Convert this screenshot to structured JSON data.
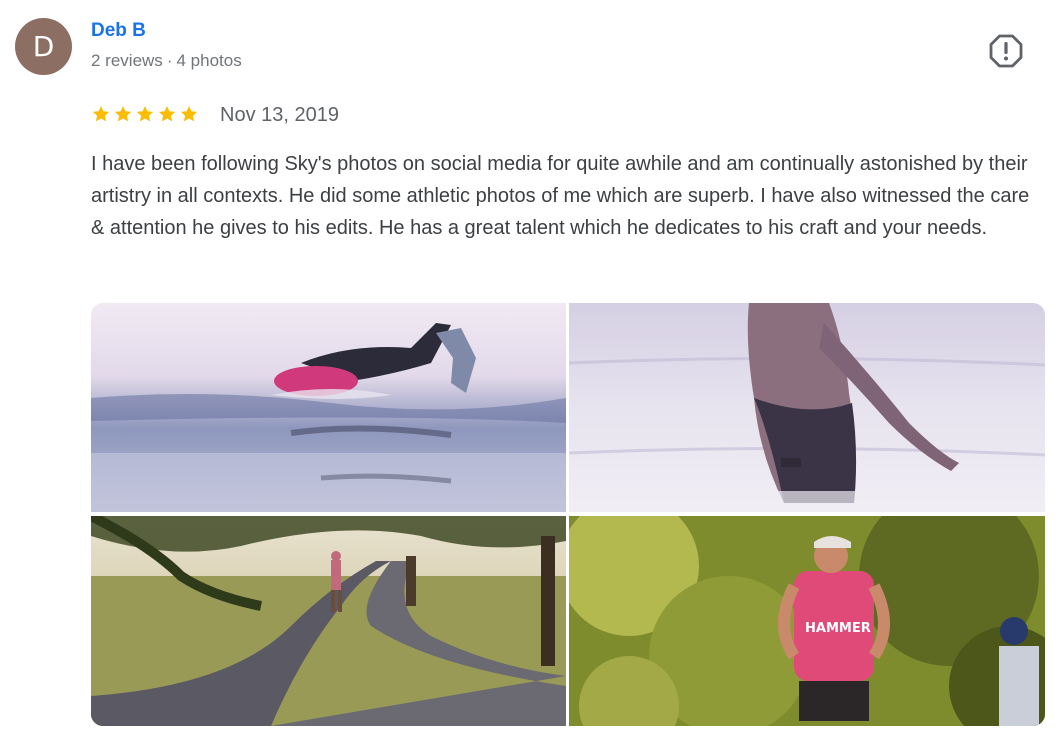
{
  "author": {
    "initial": "D",
    "name": "Deb B",
    "reviews": "2 reviews",
    "separator": "·",
    "photos": "4 photos",
    "avatar_color": "#8d6e63"
  },
  "report_icon": "report-flag-icon",
  "rating": {
    "stars": 5,
    "max": 5,
    "star_color": "#fbbc04"
  },
  "date": "Nov 13, 2019",
  "review_text": "I have been following Sky's photos on social media for quite awhile and am continually astonished by their artistry in all contexts. He did some athletic photos of me which are superb. I have also witnessed the care & attention he gives to his edits. He has a great talent which he dedicates to his craft and your needs.",
  "photos": [
    {
      "name": "photo-swimmer"
    },
    {
      "name": "photo-wading-woman"
    },
    {
      "name": "photo-runner-path"
    },
    {
      "name": "photo-runner-trees",
      "shirt_text": "HAMMER"
    }
  ],
  "colors": {
    "link": "#1a73e8",
    "meta": "#70757a",
    "text": "#3c4043"
  }
}
